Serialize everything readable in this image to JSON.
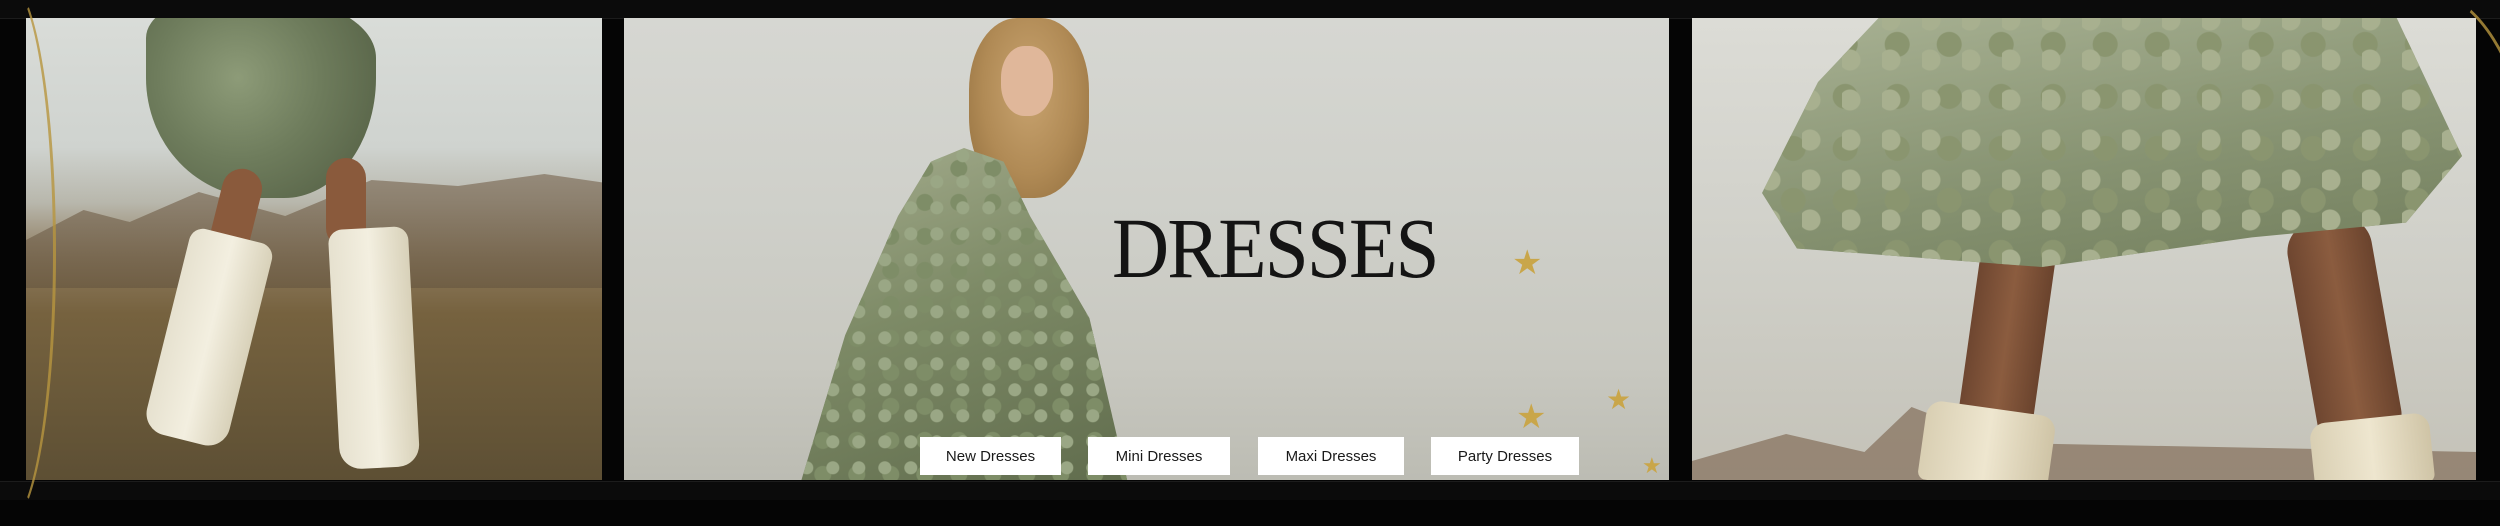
{
  "hero": {
    "title": "DRESSES"
  },
  "nav_buttons": [
    {
      "label": "New Dresses"
    },
    {
      "label": "Mini Dresses"
    },
    {
      "label": "Maxi Dresses"
    },
    {
      "label": "Party Dresses"
    }
  ],
  "icons": {
    "decoration": "star-icon",
    "star_glyph": "★"
  },
  "colors": {
    "background": "#050505",
    "title_text": "#141414",
    "button_bg": "#ffffff",
    "button_text": "#1a1a1a",
    "star_gold": "#c9a64a"
  }
}
